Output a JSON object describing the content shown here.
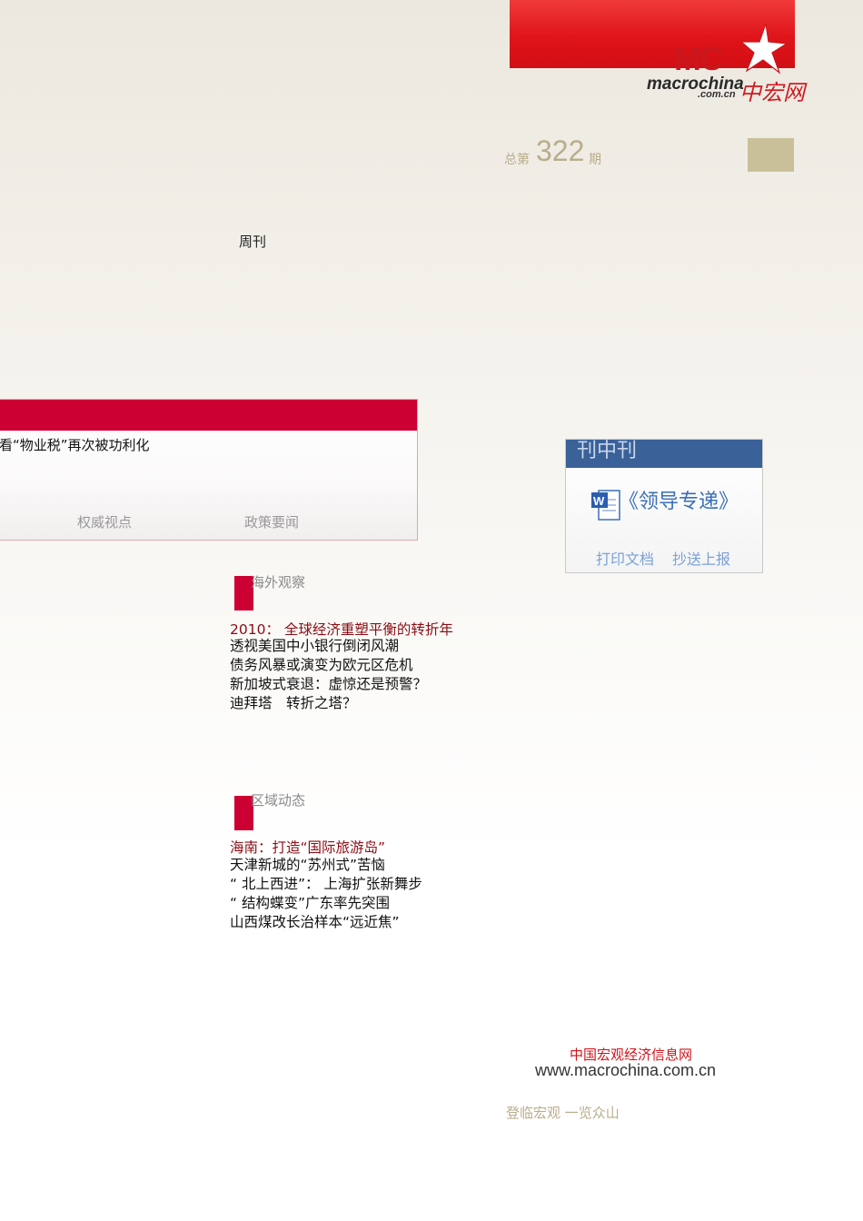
{
  "header": {
    "logo_mark": "MC",
    "logo_word": "macrochina",
    "logo_domain": ".com.cn",
    "logo_cn": "中宏网",
    "issue_prefix": "总第",
    "issue_number": "322",
    "issue_suffix": "期",
    "weekly": "周刊"
  },
  "panel": {
    "headline": "看“物业税”再次被功利化",
    "tabs": [
      "权威视点",
      "政策要闻"
    ]
  },
  "side_box": {
    "title": "刊中刊",
    "book": "《领导专递》",
    "icon": "word-document-icon",
    "actions": [
      "打印文档",
      "抄送上报"
    ]
  },
  "sections": [
    {
      "title": "海外观察",
      "lead": "2010： 全球经济重塑平衡的转折年",
      "items": [
        "透视美国中小银行倒闭风潮",
        "债务风暴或演变为欧元区危机",
        "新加坡式衰退：虚惊还是预警？",
        "迪拜塔　转折之塔？"
      ]
    },
    {
      "title": "区域动态",
      "lead": "海南：打造“国际旅游岛”",
      "items": [
        "天津新城的“苏州式”苦恼",
        "“ 北上西进”： 上海扩张新舞步",
        "“ 结构蝶变”广东率先突围",
        "山西煤改长治样本“远近焦”"
      ]
    }
  ],
  "footer": {
    "site_name": "中国宏观经济信息网",
    "url": "www.macrochina.com.cn",
    "slogan": "登临宏观  一览众山"
  },
  "colors": {
    "brand_red": "#cc0033",
    "banner_red": "#e0141a",
    "tan": "#c9c09a",
    "side_blue": "#3a6198"
  }
}
